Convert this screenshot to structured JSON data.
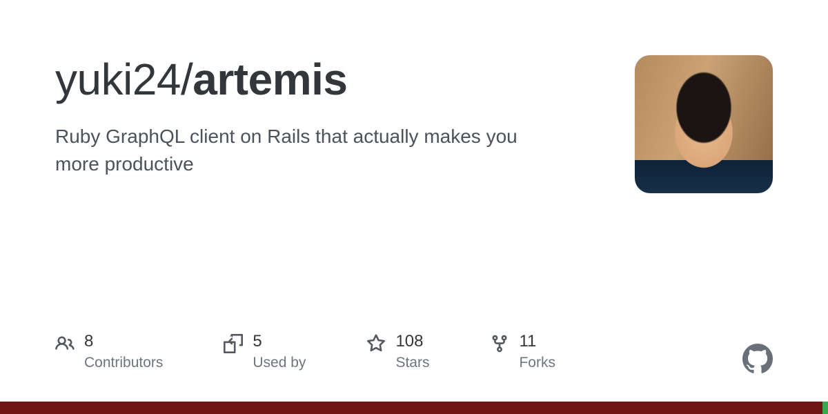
{
  "repo": {
    "owner": "yuki24",
    "slash": "/",
    "name": "artemis",
    "description": "Ruby GraphQL client on Rails that actually makes you more productive"
  },
  "stats": {
    "contributors": {
      "value": "8",
      "label": "Contributors"
    },
    "used_by": {
      "value": "5",
      "label": "Used by"
    },
    "stars": {
      "value": "108",
      "label": "Stars"
    },
    "forks": {
      "value": "11",
      "label": "Forks"
    }
  },
  "language_bar": [
    {
      "color": "#701516",
      "percent": 99.3
    },
    {
      "color": "#3ba84e",
      "percent": 0.7
    }
  ]
}
